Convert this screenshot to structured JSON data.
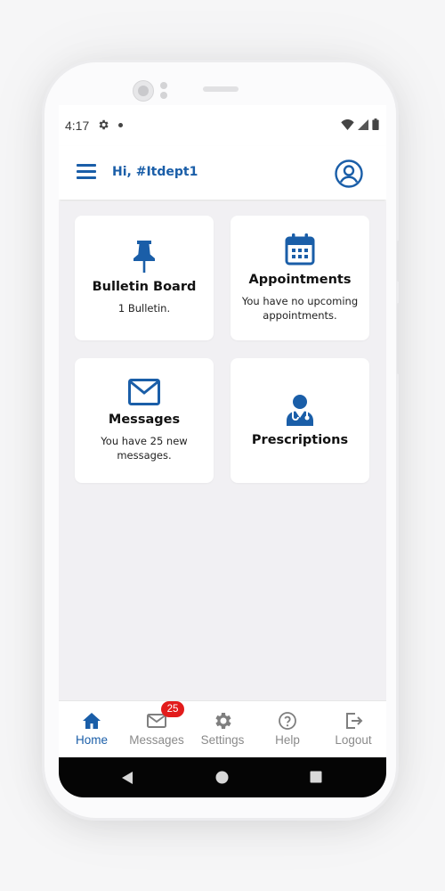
{
  "status_bar": {
    "time": "4:17"
  },
  "header": {
    "greeting": "Hi, #Itdept1"
  },
  "cards": [
    {
      "title": "Bulletin Board",
      "subtitle": "1 Bulletin.",
      "icon": "pushpin-icon"
    },
    {
      "title": "Appointments",
      "subtitle": "You have no upcoming appointments.",
      "icon": "calendar-icon"
    },
    {
      "title": "Messages",
      "subtitle": "You have 25 new messages.",
      "icon": "envelope-icon"
    },
    {
      "title": "Prescriptions",
      "subtitle": "",
      "icon": "doctor-stethoscope-icon"
    }
  ],
  "bottom_nav": {
    "items": [
      {
        "label": "Home",
        "icon": "home-icon",
        "active": true
      },
      {
        "label": "Messages",
        "icon": "envelope-icon",
        "badge": "25"
      },
      {
        "label": "Settings",
        "icon": "gear-icon"
      },
      {
        "label": "Help",
        "icon": "help-circle-icon"
      },
      {
        "label": "Logout",
        "icon": "logout-icon"
      }
    ]
  },
  "colors": {
    "accent": "#1a5ea8",
    "badge": "#e21b1b",
    "background": "#f1f0f3",
    "inactive": "#8a8a8a"
  }
}
